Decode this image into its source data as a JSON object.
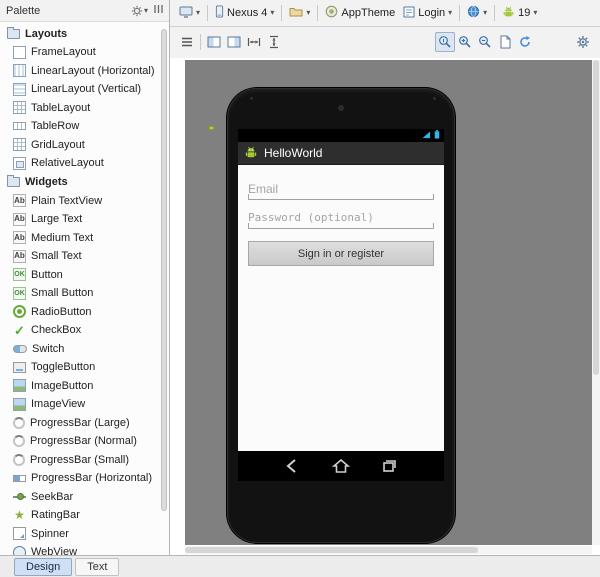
{
  "palette": {
    "title": "Palette",
    "sections": [
      {
        "label": "Layouts",
        "items": [
          {
            "label": "FrameLayout",
            "icon": "ic-frame",
            "icon_name": "framelayout-icon"
          },
          {
            "label": "LinearLayout (Horizontal)",
            "icon": "ic-linh",
            "icon_name": "linearlayout-horizontal-icon"
          },
          {
            "label": "LinearLayout (Vertical)",
            "icon": "ic-linv",
            "icon_name": "linearlayout-vertical-icon"
          },
          {
            "label": "TableLayout",
            "icon": "ic-table",
            "icon_name": "tablelayout-icon"
          },
          {
            "label": "TableRow",
            "icon": "ic-row",
            "icon_name": "tablerow-icon"
          },
          {
            "label": "GridLayout",
            "icon": "ic-grid",
            "icon_name": "gridlayout-icon"
          },
          {
            "label": "RelativeLayout",
            "icon": "ic-rel",
            "icon_name": "relativelayout-icon"
          }
        ]
      },
      {
        "label": "Widgets",
        "items": [
          {
            "label": "Plain TextView",
            "icon": "ic-ab",
            "icon_name": "plain-textview-icon"
          },
          {
            "label": "Large Text",
            "icon": "ic-ab",
            "icon_name": "large-text-icon"
          },
          {
            "label": "Medium Text",
            "icon": "ic-ab",
            "icon_name": "medium-text-icon"
          },
          {
            "label": "Small Text",
            "icon": "ic-ab",
            "icon_name": "small-text-icon"
          },
          {
            "label": "Button",
            "icon": "ic-ok",
            "icon_name": "button-icon"
          },
          {
            "label": "Small Button",
            "icon": "ic-ok",
            "icon_name": "small-button-icon"
          },
          {
            "label": "RadioButton",
            "icon": "ic-radio",
            "icon_name": "radiobutton-icon"
          },
          {
            "label": "CheckBox",
            "icon": "ic-check",
            "icon_name": "checkbox-icon"
          },
          {
            "label": "Switch",
            "icon": "ic-switch",
            "icon_name": "switch-icon"
          },
          {
            "label": "ToggleButton",
            "icon": "ic-toggle",
            "icon_name": "togglebutton-icon"
          },
          {
            "label": "ImageButton",
            "icon": "ic-img",
            "icon_name": "imagebutton-icon"
          },
          {
            "label": "ImageView",
            "icon": "ic-img",
            "icon_name": "imageview-icon"
          },
          {
            "label": "ProgressBar (Large)",
            "icon": "ic-prog",
            "icon_name": "progressbar-large-icon"
          },
          {
            "label": "ProgressBar (Normal)",
            "icon": "ic-prog",
            "icon_name": "progressbar-normal-icon"
          },
          {
            "label": "ProgressBar (Small)",
            "icon": "ic-prog",
            "icon_name": "progressbar-small-icon"
          },
          {
            "label": "ProgressBar (Horizontal)",
            "icon": "ic-progh",
            "icon_name": "progressbar-horizontal-icon"
          },
          {
            "label": "SeekBar",
            "icon": "ic-seek",
            "icon_name": "seekbar-icon"
          },
          {
            "label": "RatingBar",
            "icon": "ic-rating",
            "icon_name": "ratingbar-icon"
          },
          {
            "label": "Spinner",
            "icon": "ic-spinner",
            "icon_name": "spinner-icon"
          },
          {
            "label": "WebView",
            "icon": "ic-web",
            "icon_name": "webview-icon"
          }
        ]
      }
    ]
  },
  "toolbar": {
    "device": "Nexus 4",
    "theme": "AppTheme",
    "activity": "Login",
    "api_level": "19"
  },
  "icons": {
    "palette_header": [
      "gear-icon",
      "hide-icon"
    ],
    "toolbar1": [
      "device-config-icon",
      "phone-icon",
      "render-folder-icon",
      "theme-icon",
      "activity-icon",
      "globe-icon",
      "android-icon"
    ],
    "toolbar2": [
      "layout-lines-icon",
      "pane-left-icon",
      "pane-right-icon",
      "width-resize-icon",
      "height-resize-icon",
      "zoom-actual-icon",
      "zoom-in-icon",
      "zoom-out-icon",
      "zoom-fit-icon",
      "refresh-icon",
      "settings-gear-icon"
    ],
    "statusbar": [
      "wifi-icon",
      "battery-icon"
    ],
    "navbar": [
      "back-icon",
      "home-icon",
      "recents-icon"
    ]
  },
  "device_screen": {
    "app_title": "HelloWorld",
    "email_hint": "Email",
    "password_hint": "Password (optional)",
    "signin_button": "Sign in or register"
  },
  "tabs": [
    {
      "label": "Design",
      "selected": true
    },
    {
      "label": "Text",
      "selected": false
    }
  ],
  "colors": {
    "canvas_bg": "#808080",
    "holo_blue": "#33b5e5",
    "android_green": "#a4c639",
    "actionbar_bg": "#2e2e2e"
  }
}
